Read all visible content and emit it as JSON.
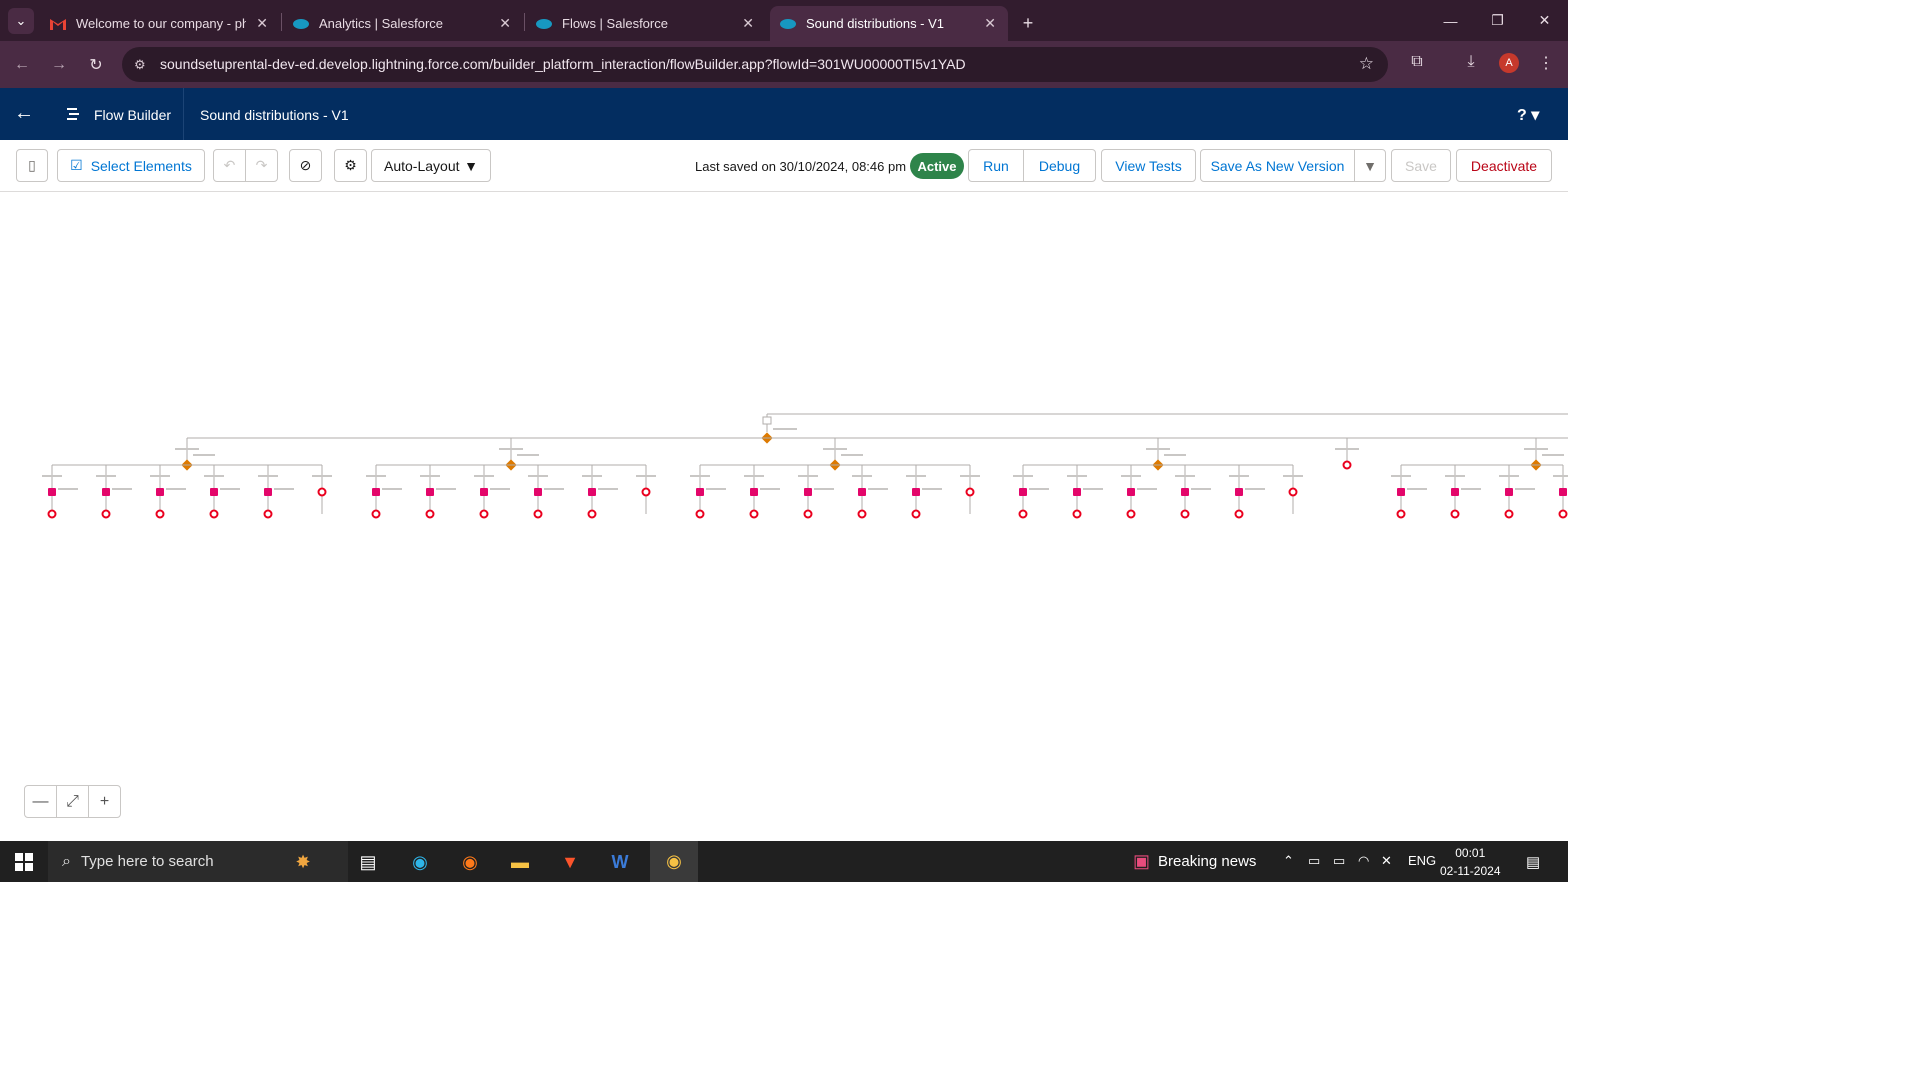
{
  "browser": {
    "tabs": [
      {
        "label": "Welcome to our company - phu",
        "icon": "gmail-icon"
      },
      {
        "label": "Analytics | Salesforce",
        "icon": "salesforce-icon"
      },
      {
        "label": "Flows | Salesforce",
        "icon": "salesforce-icon"
      },
      {
        "label": "Sound distributions - V1",
        "icon": "salesforce-icon",
        "active": true
      }
    ],
    "url": "soundsetuprental-dev-ed.develop.lightning.force.com/builder_platform_interaction/flowBuilder.app?flowId=301WU00000TI5v1YAD",
    "avatar_letter": "A"
  },
  "header": {
    "app_title": "Flow Builder",
    "flow_name": "Sound distributions - V1",
    "help": "?"
  },
  "toolbar": {
    "select_elements": "Select Elements",
    "layout_select": "Auto-Layout",
    "last_saved": "Last saved on 30/10/2024, 08:46 pm",
    "status": "Active",
    "run": "Run",
    "debug": "Debug",
    "view_tests": "View Tests",
    "save_as_new_version": "Save As New Version",
    "save": "Save",
    "deactivate": "Deactivate"
  },
  "canvas": {
    "decision_branches": 6,
    "outcome_columns_per_branch": [
      6,
      6,
      6,
      6,
      0,
      4
    ]
  },
  "taskbar": {
    "search_placeholder": "Type here to search",
    "news": "Breaking news",
    "language": "ENG",
    "time": "00:01",
    "date": "02-11-2024"
  },
  "colors": {
    "sf_navy": "#032d60",
    "decision_orange": "#dd7a01",
    "action_pink": "#e3066a",
    "end_red": "#ea001e",
    "active_green": "#2e844a"
  }
}
